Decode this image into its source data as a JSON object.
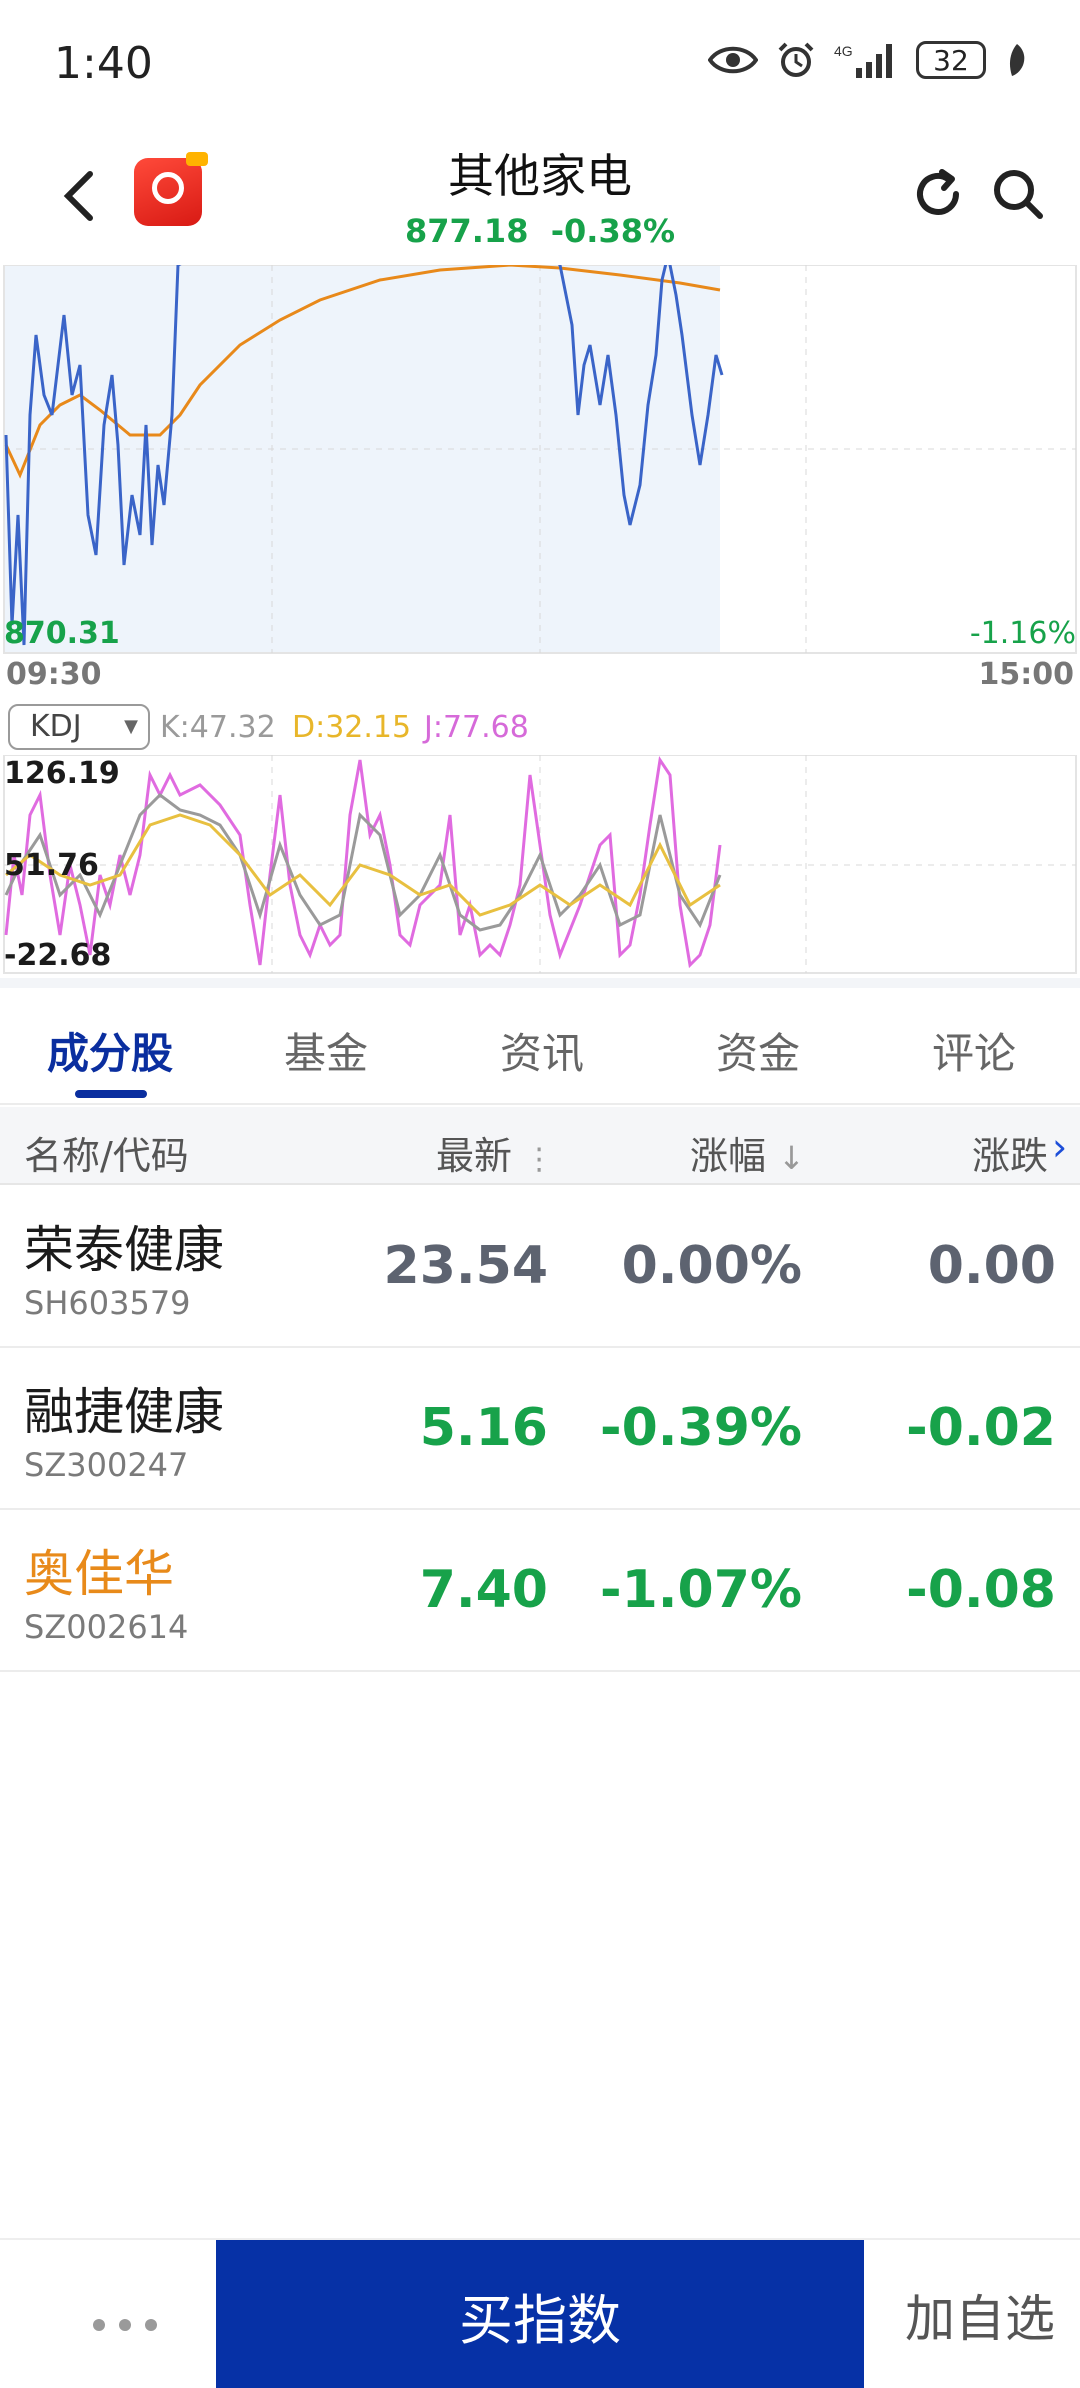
{
  "status": {
    "time": "1:40",
    "battery": "32",
    "net": "4G"
  },
  "header": {
    "title": "其他家电",
    "price": "877.18",
    "change": "-0.38%"
  },
  "chart": {
    "low_label": "870.31",
    "pct_label": "-1.16%",
    "time_start": "09:30",
    "time_end": "15:00"
  },
  "kdj": {
    "indicator": "KDJ",
    "k": "K:47.32",
    "d": "D:32.15",
    "j": "J:77.68",
    "y_top": "126.19",
    "y_mid": "51.76",
    "y_bot": "-22.68"
  },
  "tabs": [
    "成分股",
    "基金",
    "资讯",
    "资金",
    "评论"
  ],
  "table": {
    "headers": {
      "name": "名称/代码",
      "latest": "最新",
      "change_pct": "涨幅",
      "change": "涨跌"
    },
    "rows": [
      {
        "name": "荣泰健康",
        "code": "SH603579",
        "latest": "23.54",
        "change_pct": "0.00%",
        "change": "0.00"
      },
      {
        "name": "融捷健康",
        "code": "SZ300247",
        "latest": "5.16",
        "change_pct": "-0.39%",
        "change": "-0.02"
      },
      {
        "name": "奥佳华",
        "code": "SZ002614",
        "latest": "7.40",
        "change_pct": "-1.07%",
        "change": "-0.08"
      }
    ]
  },
  "bottom": {
    "buy": "买指数",
    "watch": "加自选"
  },
  "colors": {
    "accent": "#0a2e9f",
    "down": "#17a24a",
    "flat": "#6b6b6b",
    "highlight": "#e88a1a"
  }
}
